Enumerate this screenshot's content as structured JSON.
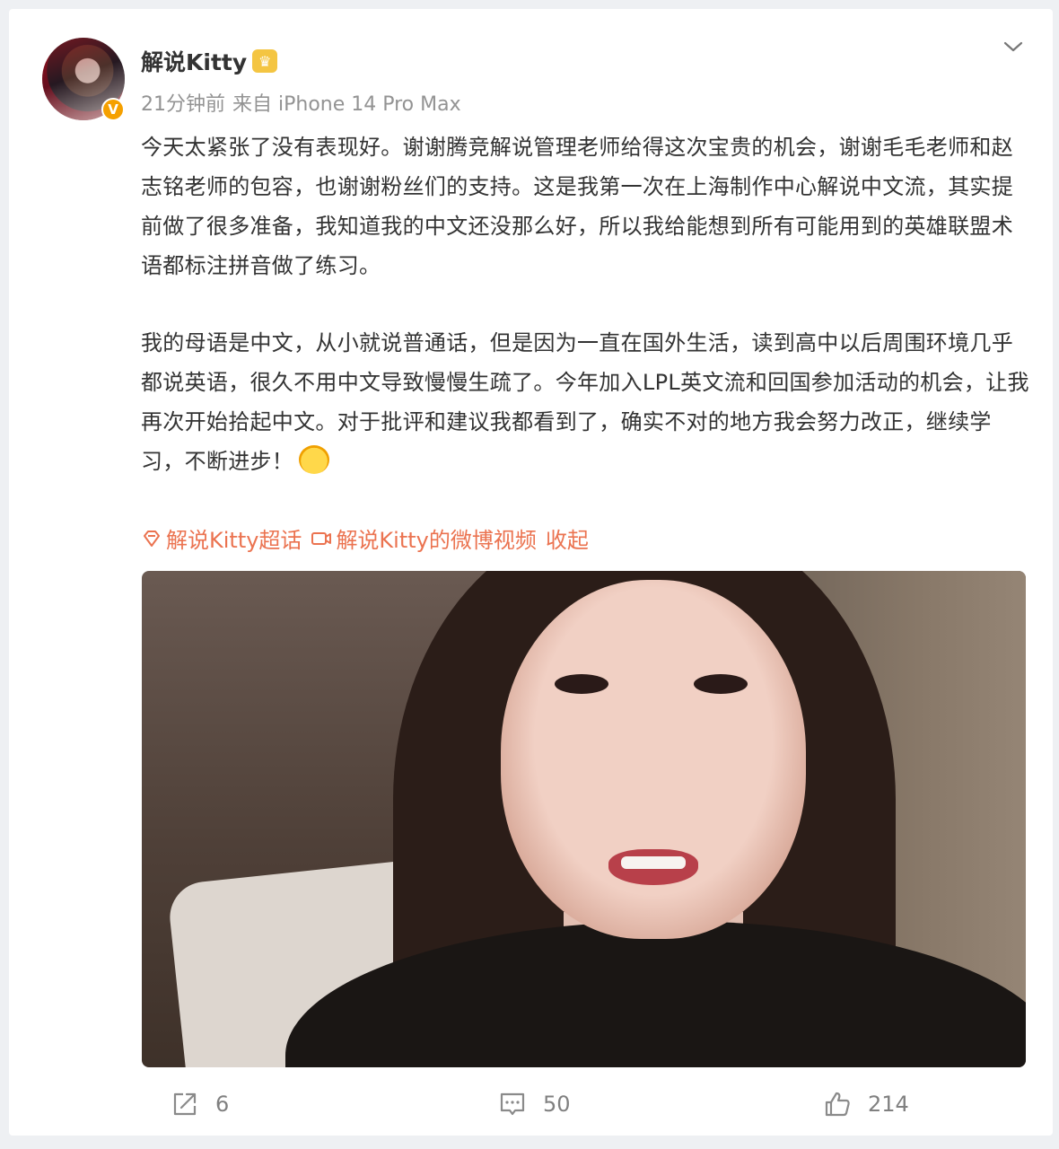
{
  "post": {
    "username": "解说Kitty",
    "time": "21分钟前",
    "source": "来自 iPhone 14 Pro Max",
    "paragraph1": "今天太紧张了没有表现好。谢谢腾竞解说管理老师给得这次宝贵的机会，谢谢毛毛老师和赵志铭老师的包容，也谢谢粉丝们的支持。这是我第一次在上海制作中心解说中文流，其实提前做了很多准备，我知道我的中文还没那么好，所以我给能想到所有可能用到的英雄联盟术语都标注拼音做了练习。",
    "paragraph2": "我的母语是中文，从小就说普通话，但是因为一直在国外生活，读到高中以后周围环境几乎都说英语，很久不用中文导致慢慢生疏了。今年加入LPL英文流和回国参加活动的机会，让我再次开始拾起中文。对于批评和建议我都看到了，确实不对的地方我会努力改正，继续学习，不断进步！",
    "supertopic_link": "解说Kitty超话",
    "video_link": "解说Kitty的微博视频",
    "collapse_link": "收起"
  },
  "actions": {
    "repost_count": "6",
    "comment_count": "50",
    "like_count": "214"
  },
  "colors": {
    "link": "#eb7350",
    "verified_badge": "#f5a000",
    "meta_text": "#939393",
    "action_text": "#808080"
  },
  "icons": [
    "chevron-down-icon",
    "supertopic-icon",
    "video-icon",
    "repost-icon",
    "comment-icon",
    "like-icon",
    "verified-icon",
    "crown-icon",
    "emoji-icon"
  ]
}
